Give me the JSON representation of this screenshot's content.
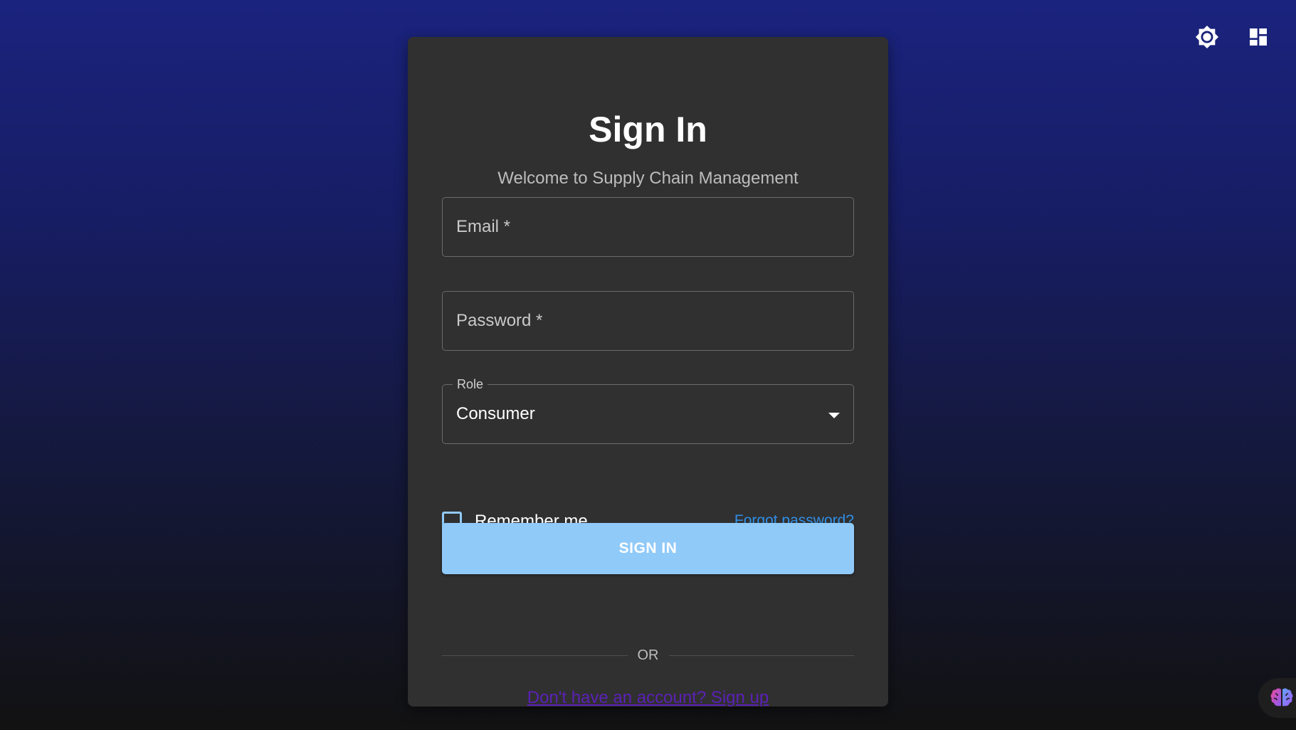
{
  "header": {
    "icons": [
      "brightness-icon",
      "dashboard-icon"
    ]
  },
  "login": {
    "title": "Sign In",
    "subtitle": "Welcome to Supply Chain Management",
    "email": {
      "label": "Email *",
      "value": ""
    },
    "password": {
      "label": "Password *",
      "value": ""
    },
    "role": {
      "label": "Role",
      "value": "Consumer"
    },
    "remember_label": "Remember me",
    "forgot_label": "Forgot password?",
    "signin_label": "SIGN IN",
    "divider_label": "OR",
    "signup_label": "Don't have an account? Sign up"
  },
  "colors": {
    "accent": "#90caf9",
    "link": "#2f8fe6",
    "signup_link": "#5b21b6",
    "card": "#303030"
  },
  "assistant": {
    "icon": "brain-icon"
  }
}
